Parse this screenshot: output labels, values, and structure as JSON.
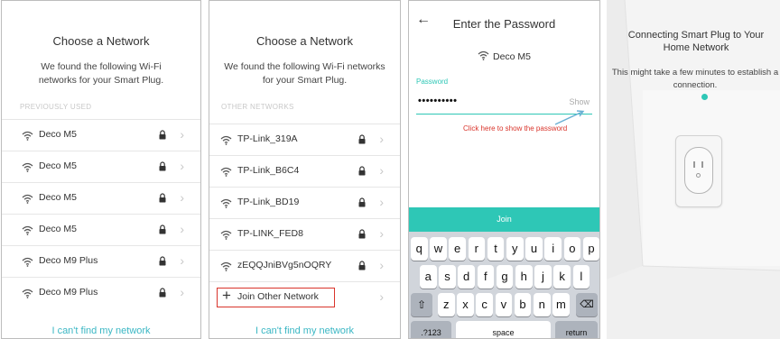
{
  "colors": {
    "teal": "#2ec7b6",
    "link": "#3bb7c4",
    "red": "#d9342b"
  },
  "panel1": {
    "title": "Choose a Network",
    "subtitle": "We found the following Wi-Fi networks for your Smart Plug.",
    "section": "PREVIOUSLY USED",
    "networks": [
      "Deco M5",
      "Deco M5",
      "Deco M5",
      "Deco M5",
      "Deco M9 Plus",
      "Deco M9 Plus"
    ],
    "footer": "I can't find my network"
  },
  "panel2": {
    "title": "Choose a Network",
    "subtitle": "We found the following Wi-Fi networks for your Smart Plug.",
    "section": "OTHER NETWORKS",
    "networks": [
      "TP-Link_319A",
      "TP-Link_B6C4",
      "TP-Link_BD19",
      "TP-LINK_FED8",
      "zEQQJniBVg5nOQRY"
    ],
    "join_other": "Join Other Network",
    "footer": "I can't find my network"
  },
  "panel3": {
    "back_icon": "back-arrow-icon",
    "title": "Enter the Password",
    "network": "Deco M5",
    "password_label": "Password",
    "password_value": "••••••••••",
    "show_label": "Show",
    "annotation": "Click here to show the password",
    "join_button": "Join",
    "keyboard": {
      "row1": [
        "q",
        "w",
        "e",
        "r",
        "t",
        "y",
        "u",
        "i",
        "o",
        "p"
      ],
      "row2": [
        "a",
        "s",
        "d",
        "f",
        "g",
        "h",
        "j",
        "k",
        "l"
      ],
      "row3": [
        "z",
        "x",
        "c",
        "v",
        "b",
        "n",
        "m"
      ],
      "numbers": ".?123",
      "space": "space",
      "return": "return"
    }
  },
  "panel4": {
    "title": "Connecting Smart Plug to Your Home Network",
    "subtitle": "This might take a few minutes to establish a connection."
  }
}
